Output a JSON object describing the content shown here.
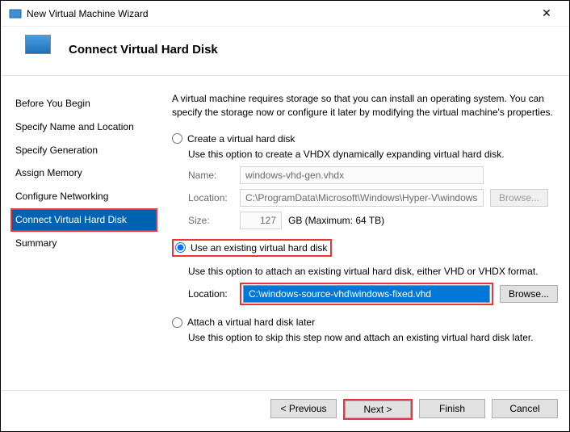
{
  "window": {
    "title": "New Virtual Machine Wizard"
  },
  "header": {
    "title": "Connect Virtual Hard Disk"
  },
  "sidebar": {
    "steps": [
      {
        "label": "Before You Begin"
      },
      {
        "label": "Specify Name and Location"
      },
      {
        "label": "Specify Generation"
      },
      {
        "label": "Assign Memory"
      },
      {
        "label": "Configure Networking"
      },
      {
        "label": "Connect Virtual Hard Disk",
        "active": true
      },
      {
        "label": "Summary"
      }
    ]
  },
  "main": {
    "intro": "A virtual machine requires storage so that you can install an operating system. You can specify the storage now or configure it later by modifying the virtual machine's properties.",
    "option_create": {
      "label": "Create a virtual hard disk",
      "desc": "Use this option to create a VHDX dynamically expanding virtual hard disk.",
      "name_label": "Name:",
      "name_value": "windows-vhd-gen.vhdx",
      "location_label": "Location:",
      "location_value": "C:\\ProgramData\\Microsoft\\Windows\\Hyper-V\\windows-vhd-gen\\Vir",
      "browse_label": "Browse...",
      "size_label": "Size:",
      "size_value": "127",
      "size_suffix": "GB (Maximum: 64 TB)"
    },
    "option_existing": {
      "label": "Use an existing virtual hard disk",
      "desc": "Use this option to attach an existing virtual hard disk, either VHD or VHDX format.",
      "location_label": "Location:",
      "location_value": "C:\\windows-source-vhd\\windows-fixed.vhd",
      "browse_label": "Browse..."
    },
    "option_later": {
      "label": "Attach a virtual hard disk later",
      "desc": "Use this option to skip this step now and attach an existing virtual hard disk later."
    }
  },
  "footer": {
    "previous": "< Previous",
    "next": "Next >",
    "finish": "Finish",
    "cancel": "Cancel"
  }
}
